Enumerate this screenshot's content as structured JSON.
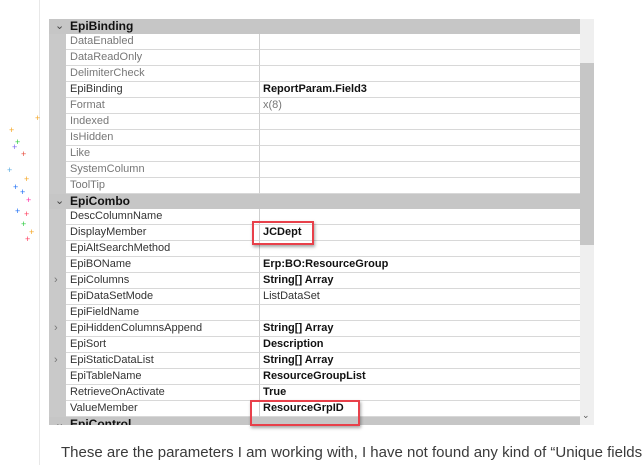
{
  "grid": {
    "categories": [
      {
        "label": "EpiBinding",
        "expanded": true,
        "rows": [
          {
            "name": "DataEnabled",
            "value": "",
            "style": "dim"
          },
          {
            "name": "DataReadOnly",
            "value": "",
            "style": "dim"
          },
          {
            "name": "DelimiterCheck",
            "value": "",
            "style": "dim"
          },
          {
            "name": "EpiBinding",
            "value": "ReportParam.Field3",
            "style": "bold"
          },
          {
            "name": "Format",
            "value": "x(8)",
            "style": "dim"
          },
          {
            "name": "Indexed",
            "value": "",
            "style": "dim"
          },
          {
            "name": "IsHidden",
            "value": "",
            "style": "dim"
          },
          {
            "name": "Like",
            "value": "",
            "style": "dim"
          },
          {
            "name": "SystemColumn",
            "value": "",
            "style": "dim"
          },
          {
            "name": "ToolTip",
            "value": "",
            "style": "dim"
          }
        ]
      },
      {
        "label": "EpiCombo",
        "expanded": true,
        "rows": [
          {
            "name": "DescColumnName",
            "value": "",
            "style": "plain"
          },
          {
            "name": "DisplayMember",
            "value": "JCDept",
            "style": "bold"
          },
          {
            "name": "EpiAltSearchMethod",
            "value": "",
            "style": "plain"
          },
          {
            "name": "EpiBOName",
            "value": "Erp:BO:ResourceGroup",
            "style": "bold"
          },
          {
            "name": "EpiColumns",
            "value": "String[] Array",
            "style": "bold",
            "expandable": true
          },
          {
            "name": "EpiDataSetMode",
            "value": "ListDataSet",
            "style": "plain"
          },
          {
            "name": "EpiFieldName",
            "value": "",
            "style": "plain"
          },
          {
            "name": "EpiHiddenColumnsAppend",
            "value": "String[] Array",
            "style": "bold",
            "expandable": true
          },
          {
            "name": "EpiSort",
            "value": "Description",
            "style": "bold"
          },
          {
            "name": "EpiStaticDataList",
            "value": "String[] Array",
            "style": "bold",
            "expandable": true
          },
          {
            "name": "EpiTableName",
            "value": "ResourceGroupList",
            "style": "bold"
          },
          {
            "name": "RetrieveOnActivate",
            "value": "True",
            "style": "bold"
          },
          {
            "name": "ValueMember",
            "value": "ResourceGrpID",
            "style": "bold"
          }
        ]
      },
      {
        "label": "EpiControl",
        "expanded": true,
        "rows": []
      }
    ]
  },
  "caption": "These are the parameters I am working with, I have not found any kind of “Unique fields",
  "colors": {
    "highlight_box": "#e8404a",
    "category_bg": "#c6c6c6"
  }
}
